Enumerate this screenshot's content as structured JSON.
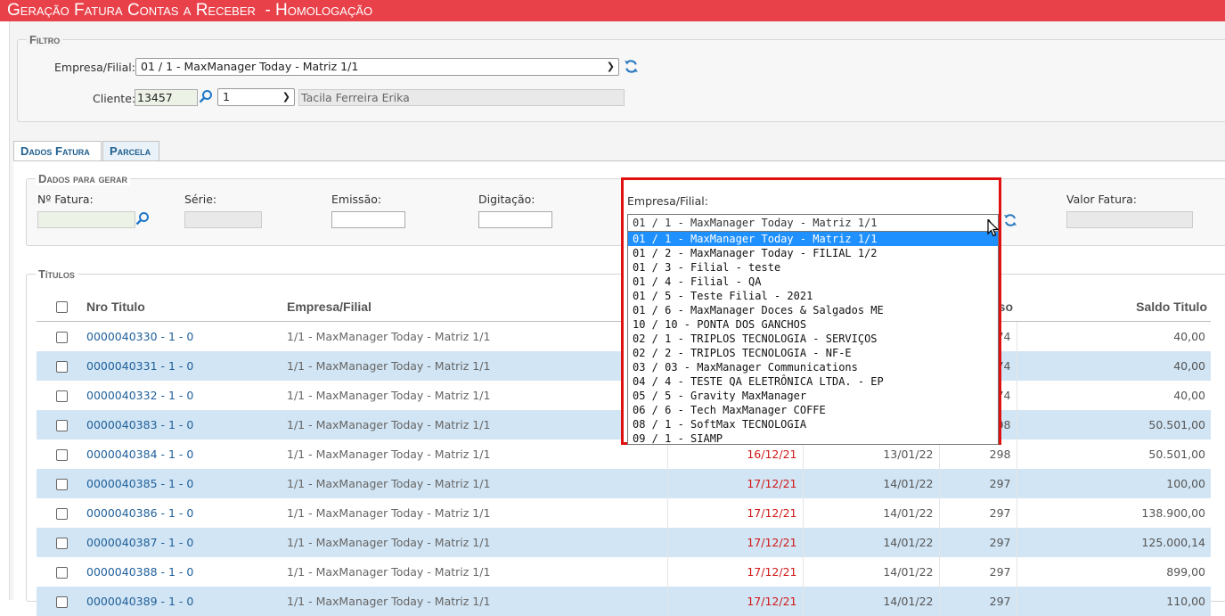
{
  "window": {
    "title": "Geração Fatura Contas a Receber  - Homologação"
  },
  "filtro": {
    "legend": "Filtro",
    "empresa_label": "Empresa/Filial:",
    "empresa_value": "01 / 1 - MaxManager Today - Matriz 1/1",
    "cliente_label": "Cliente:",
    "cliente_code": "13457",
    "cliente_seq": "1",
    "cliente_name": "Tacila Ferreira Erika"
  },
  "tabs": [
    {
      "label": "Dados Fatura"
    },
    {
      "label": "Parcela"
    }
  ],
  "dados": {
    "legend": "Dados para gerar",
    "nfatura_label": "Nº Fatura:",
    "serie_label": "Série:",
    "emissao_label": "Emissão:",
    "digitacao_label": "Digitação:",
    "valor_label": "Valor Fatura:"
  },
  "titulos": {
    "legend": "Títulos",
    "columns": [
      "Nro Titulo",
      "Empresa/Filial",
      "so",
      "Saldo Titulo"
    ],
    "rows": [
      {
        "nro": "0000040330 - 1 - 0",
        "emp": "1/1 - MaxManager Today - Matriz 1/1",
        "d1": "",
        "d2": "",
        "dias": "274",
        "saldo": "40,00"
      },
      {
        "nro": "0000040331 - 1 - 0",
        "emp": "1/1 - MaxManager Today - Matriz 1/1",
        "d1": "",
        "d2": "",
        "dias": "274",
        "saldo": "40,00"
      },
      {
        "nro": "0000040332 - 1 - 0",
        "emp": "1/1 - MaxManager Today - Matriz 1/1",
        "d1": "",
        "d2": "",
        "dias": "274",
        "saldo": "40,00"
      },
      {
        "nro": "0000040383 - 1 - 0",
        "emp": "1/1 - MaxManager Today - Matriz 1/1",
        "d1": "",
        "d2": "",
        "dias": "298",
        "saldo": "50.501,00"
      },
      {
        "nro": "0000040384 - 1 - 0",
        "emp": "1/1 - MaxManager Today - Matriz 1/1",
        "d1": "16/12/21",
        "d2": "13/01/22",
        "dias": "298",
        "saldo": "50.501,00"
      },
      {
        "nro": "0000040385 - 1 - 0",
        "emp": "1/1 - MaxManager Today - Matriz 1/1",
        "d1": "17/12/21",
        "d2": "14/01/22",
        "dias": "297",
        "saldo": "100,00"
      },
      {
        "nro": "0000040386 - 1 - 0",
        "emp": "1/1 - MaxManager Today - Matriz 1/1",
        "d1": "17/12/21",
        "d2": "14/01/22",
        "dias": "297",
        "saldo": "138.900,00"
      },
      {
        "nro": "0000040387 - 1 - 0",
        "emp": "1/1 - MaxManager Today - Matriz 1/1",
        "d1": "17/12/21",
        "d2": "14/01/22",
        "dias": "297",
        "saldo": "125.000,14"
      },
      {
        "nro": "0000040388 - 1 - 0",
        "emp": "1/1 - MaxManager Today - Matriz 1/1",
        "d1": "17/12/21",
        "d2": "14/01/22",
        "dias": "297",
        "saldo": "899,00"
      },
      {
        "nro": "0000040389 - 1 - 0",
        "emp": "1/1 - MaxManager Today - Matriz 1/1",
        "d1": "17/12/21",
        "d2": "14/01/22",
        "dias": "297",
        "saldo": "110,00"
      }
    ]
  },
  "dropdown": {
    "label": "Empresa/Filial:",
    "value": "01 / 1 - MaxManager Today - Matriz 1/1",
    "options": [
      "01 / 1 - MaxManager Today - Matriz 1/1",
      "01 / 2 - MaxManager Today - FILIAL 1/2",
      "01 / 3 - Filial - teste",
      "01 / 4 - Filial - QA",
      "01 / 5 - Teste Filial - 2021",
      "01 / 6 - MaxManager Doces & Salgados ME",
      "10 / 10 - PONTA DOS GANCHOS",
      "02 / 1 - TRIPLOS TECNOLOGIA - SERVIÇOS",
      "02 / 2 - TRIPLOS TECNOLOGIA - NF-E",
      "03 / 03 - MaxManager Communications",
      "04 / 4 - TESTE QA ELETRÔNICA LTDA. - EP",
      "05 / 5 - Gravity MaxManager",
      "06 / 6 - Tech MaxManager COFFE",
      "08 / 1 - SoftMax TECNOLOGIA",
      "09 / 1 - SIAMP"
    ],
    "selected_index": 0
  },
  "colors": {
    "title_bar": "#e8414a",
    "highlight": "#e01010",
    "selected_option": "#1e90ff",
    "row_alt": "#d2e5f4",
    "link": "#1e5f9a",
    "date_red": "#d01818"
  },
  "icons": [
    "refresh-icon",
    "search-icon",
    "chevron-down-icon",
    "cursor-icon"
  ]
}
